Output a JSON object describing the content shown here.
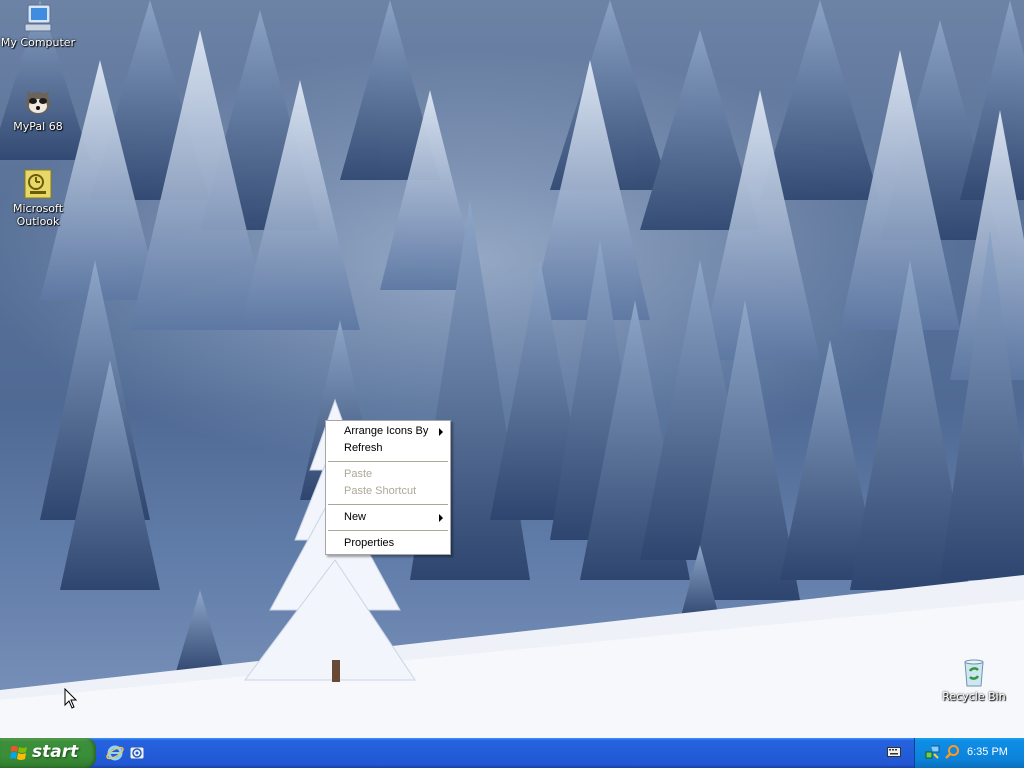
{
  "desktop": {
    "icons": [
      {
        "label": "My Computer",
        "icon": "my-computer-icon"
      },
      {
        "label": "MyPal 68",
        "icon": "mypal-icon"
      },
      {
        "label": "Microsoft Outlook",
        "icon": "outlook-icon"
      },
      {
        "label": "Recycle Bin",
        "icon": "recycle-bin-icon"
      }
    ]
  },
  "context_menu": {
    "items": [
      {
        "label": "Arrange Icons By",
        "submenu": true,
        "enabled": true
      },
      {
        "label": "Refresh",
        "submenu": false,
        "enabled": true
      },
      {
        "label": "Paste",
        "submenu": false,
        "enabled": false
      },
      {
        "label": "Paste Shortcut",
        "submenu": false,
        "enabled": false
      },
      {
        "label": "New",
        "submenu": true,
        "enabled": true
      },
      {
        "label": "Properties",
        "submenu": false,
        "enabled": true
      }
    ]
  },
  "taskbar": {
    "start_label": "start",
    "quick_launch": [
      "internet-explorer-icon",
      "outlook-express-icon"
    ],
    "tray_icons": [
      "keyboard-icon",
      "network-icon",
      "search-icon"
    ],
    "clock": "6:35 PM"
  },
  "colors": {
    "taskbar_blue": "#245edb",
    "start_green": "#3a8e38",
    "tray_blue": "#0c83da",
    "menu_disabled": "#aca899"
  }
}
